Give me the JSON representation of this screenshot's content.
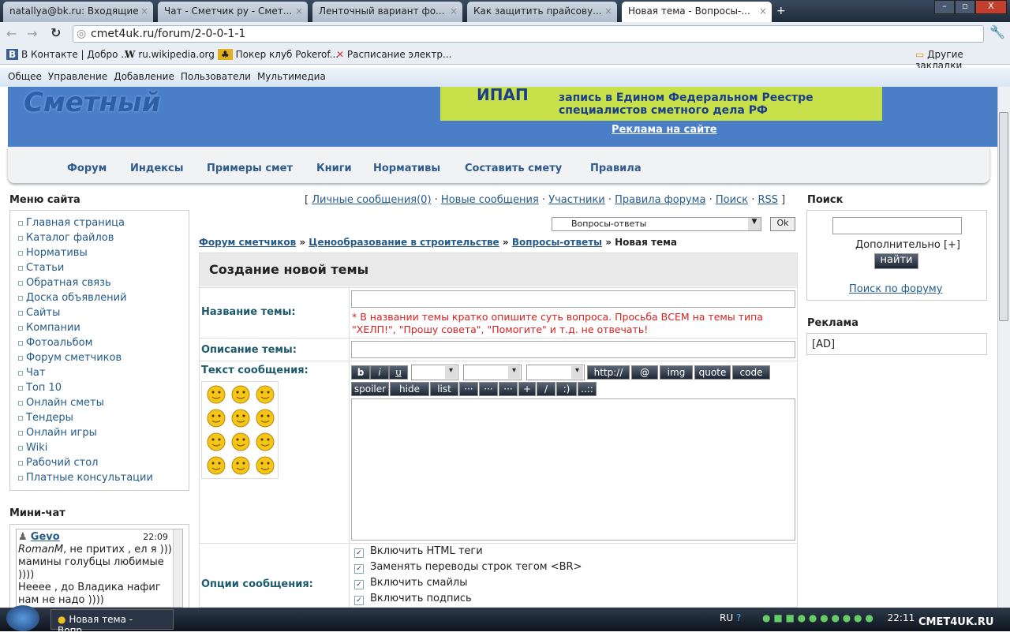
{
  "browser": {
    "tabs": [
      {
        "label": "natallya@bk.ru: Входящие"
      },
      {
        "label": "Чат - Сметчик ру - Смет..."
      },
      {
        "label": "Ленточный вариант фо..."
      },
      {
        "label": "Как защитить прайсову..."
      },
      {
        "label": "Новая тема - Вопросы-..."
      }
    ],
    "url": "cmet4uk.ru/forum/2-0-0-1-1",
    "bookmarks": [
      "В Контакте | Добро ...",
      "ru.wikipedia.org",
      "Покер клуб Pokerof...",
      "Расписание электр..."
    ],
    "other_bookmarks": "Другие закладки"
  },
  "admin_menu": [
    "Общее",
    "Управление",
    "Добавление",
    "Пользователи",
    "Мультимедиа"
  ],
  "header": {
    "logo": "Сметный",
    "banner_brand": "ИПАП",
    "banner_line1": "запись в Едином Федеральном Реестре",
    "banner_line2": "специалистов сметного дела РФ",
    "ad_link": "Реклама на сайте"
  },
  "nav": [
    "Форум",
    "Индексы",
    "Примеры смет",
    "Книги",
    "Нормативы",
    "Составить смету",
    "Правила"
  ],
  "sidebar": {
    "title": "Меню сайта",
    "items": [
      "Главная страница",
      "Каталог файлов",
      "Нормативы",
      "Статьи",
      "Обратная связь",
      "Доска объявлений",
      "Сайты",
      "Компании",
      "Фотоальбом",
      "Форум сметчиков",
      "Чат",
      "Топ 10",
      "Онлайн сметы",
      "Тендеры",
      "Онлайн игры",
      "Wiki",
      "Рабочий стол",
      "Платные консультации"
    ]
  },
  "minichat": {
    "title": "Мини-чат",
    "user": "Gevo",
    "time": "22:09",
    "mention": "RomanM",
    "msg1": ", не притих , ел я )))) мамины голубцы любимые ))))",
    "msg2": "Нееее , до Владика нафиг нам не надо ))))"
  },
  "forum": {
    "links": [
      "Личные сообщения(0)",
      "Новые сообщения",
      "Участники",
      "Правила форума",
      "Поиск",
      "RSS"
    ],
    "select": "Вопросы-ответы",
    "ok": "Ok",
    "crumbs": [
      "Форум сметчиков",
      "Ценообразование в строительстве",
      "Вопросы-ответы"
    ],
    "crumb_current": "Новая тема",
    "title": "Создание новой темы",
    "topic_label": "Название темы:",
    "topic_warning": "* В названии темы кратко опишите суть вопроса. Просьба ВСЕМ на темы типа \"ХЕЛП!\", \"Прошу совета\", \"Помогите\" и т.д. не отвечать!",
    "desc_label": "Описание темы:",
    "text_label": "Текст сообщения:",
    "toolbar1": [
      "b",
      "i",
      "u"
    ],
    "toolbar1b": [
      "http://",
      "@",
      "img",
      "quote",
      "code"
    ],
    "toolbar2": [
      "spoiler",
      "hide",
      "list",
      "···",
      "···",
      "···",
      "+",
      "/",
      ":)",
      "..::"
    ],
    "options_label": "Опции сообщения:",
    "options": [
      "Включить HTML теги",
      "Заменять переводы строк тегом <BR>",
      "Включить смайлы",
      "Включить подпись"
    ]
  },
  "search": {
    "title": "Поиск",
    "advanced": "Дополнительно [+]",
    "button": "найти",
    "forum_search": "Поиск по форуму"
  },
  "ads": {
    "title": "Реклама",
    "content": "[AD]"
  },
  "taskbar": {
    "task": "Новая тема - Вопр...",
    "lang": "RU",
    "time": "22:11",
    "watermark": "CMET4UK.RU"
  }
}
